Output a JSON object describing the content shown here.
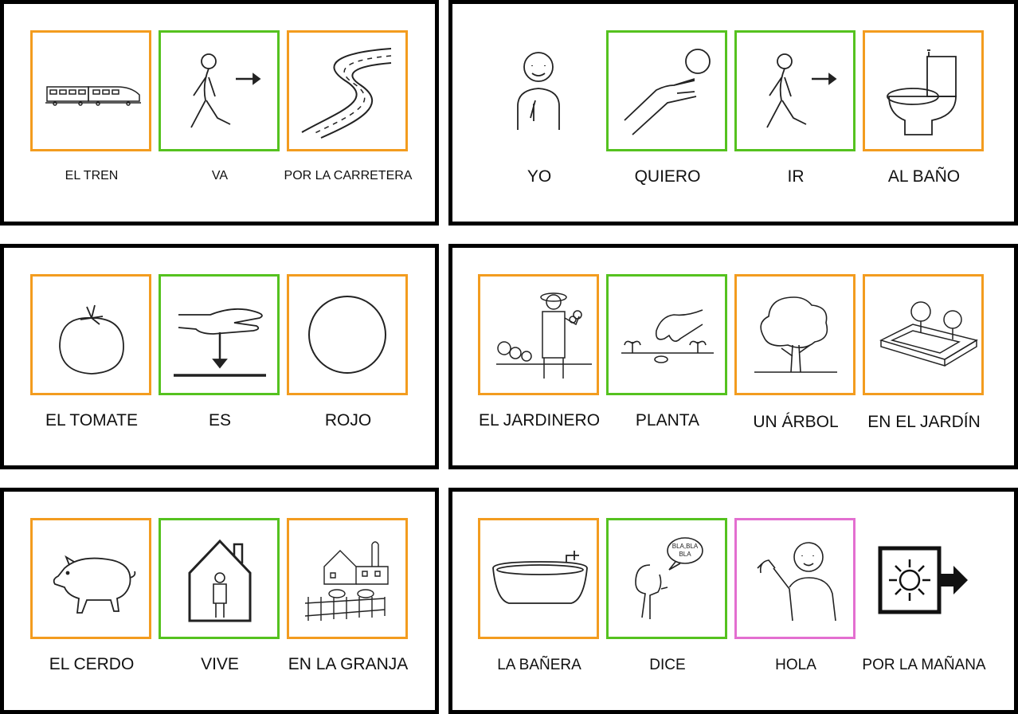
{
  "colors": {
    "noun": "#f39c1f",
    "verb": "#55c21f",
    "social": "#e36fd0",
    "border": "#000000"
  },
  "cards": [
    {
      "words": [
        {
          "label": "EL TREN",
          "category": "noun",
          "icon": "train-icon"
        },
        {
          "label": "VA",
          "category": "verb",
          "icon": "walking-person-icon"
        },
        {
          "label": "POR LA CARRETERA",
          "category": "noun",
          "icon": "road-icon"
        }
      ]
    },
    {
      "words": [
        {
          "label": "YO",
          "category": "none",
          "icon": "self-pointing-person-icon"
        },
        {
          "label": "QUIERO",
          "category": "verb",
          "icon": "reaching-hand-icon"
        },
        {
          "label": "IR",
          "category": "verb",
          "icon": "walking-person-icon"
        },
        {
          "label": "AL BAÑO",
          "category": "noun",
          "icon": "toilet-icon"
        }
      ]
    },
    {
      "words": [
        {
          "label": "EL TOMATE",
          "category": "noun",
          "icon": "tomato-icon"
        },
        {
          "label": "ES",
          "category": "verb",
          "icon": "hand-down-arrow-icon"
        },
        {
          "label": "ROJO",
          "category": "noun",
          "icon": "circle-icon"
        }
      ]
    },
    {
      "words": [
        {
          "label": "EL JARDINERO",
          "category": "noun",
          "icon": "gardener-icon"
        },
        {
          "label": "PLANTA",
          "category": "verb",
          "icon": "planting-hand-icon"
        },
        {
          "label": "UN ÁRBOL",
          "category": "noun",
          "icon": "tree-icon"
        },
        {
          "label": "EN EL JARDÍN",
          "category": "noun",
          "icon": "garden-icon"
        }
      ]
    },
    {
      "words": [
        {
          "label": "EL CERDO",
          "category": "noun",
          "icon": "pig-icon"
        },
        {
          "label": "VIVE",
          "category": "verb",
          "icon": "person-in-house-icon"
        },
        {
          "label": "EN LA GRANJA",
          "category": "noun",
          "icon": "farm-icon"
        }
      ]
    },
    {
      "words": [
        {
          "label": "LA BAÑERA",
          "category": "noun",
          "icon": "bathtub-icon"
        },
        {
          "label": "DICE",
          "category": "verb",
          "icon": "speaking-person-icon",
          "speech": "BLA,BLA BLA"
        },
        {
          "label": "HOLA",
          "category": "social",
          "icon": "waving-person-icon"
        },
        {
          "label": "POR LA MAÑANA",
          "category": "none",
          "icon": "sun-arrow-icon"
        }
      ]
    }
  ]
}
